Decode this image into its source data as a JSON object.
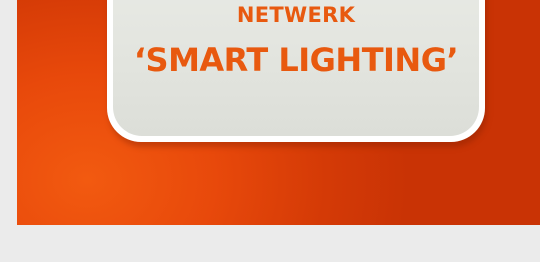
{
  "card": {
    "line1": "NETWERK",
    "line2": "‘SMART LIGHTING’"
  },
  "colors": {
    "page_background": "#ebebeb",
    "banner_orange": "#e24a0a",
    "card_background": "#e4e6e0",
    "card_border": "#ffffff",
    "text_orange": "#e8590f"
  }
}
